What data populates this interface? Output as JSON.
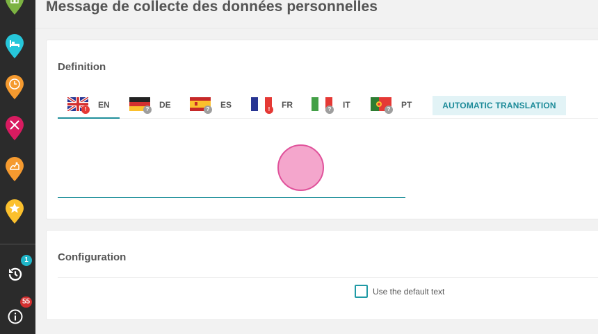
{
  "page": {
    "title": "Message de collecte des données personnelles"
  },
  "sidebar": {
    "pins": [
      {
        "icon": "building-icon",
        "color": "#7cb342"
      },
      {
        "icon": "bed-icon",
        "color": "#26c6da"
      },
      {
        "icon": "clock-icon",
        "color": "#f59a2f"
      },
      {
        "icon": "restaurant-icon",
        "color": "#d81b60"
      },
      {
        "icon": "leisure-icon",
        "color": "#f59a2f"
      },
      {
        "icon": "star-icon",
        "color": "#fbc02d"
      }
    ],
    "history": {
      "icon": "history-icon",
      "badge": "1",
      "badge_color": "#1fb6c9"
    },
    "info": {
      "icon": "info-icon",
      "badge": "55",
      "badge_color": "#d32f2f"
    }
  },
  "definition": {
    "title": "Definition",
    "tabs": [
      {
        "code": "EN",
        "flag": "uk-flag-icon",
        "badge": "!",
        "badge_type": "warn",
        "active": true
      },
      {
        "code": "DE",
        "flag": "germany-flag-icon",
        "badge": "?",
        "badge_type": "unk",
        "active": false
      },
      {
        "code": "ES",
        "flag": "spain-flag-icon",
        "badge": "?",
        "badge_type": "unk",
        "active": false
      },
      {
        "code": "FR",
        "flag": "france-flag-icon",
        "badge": "!",
        "badge_type": "warn",
        "active": false
      },
      {
        "code": "IT",
        "flag": "italy-flag-icon",
        "badge": "?",
        "badge_type": "unk",
        "active": false
      },
      {
        "code": "PT",
        "flag": "portugal-flag-icon",
        "badge": "?",
        "badge_type": "unk",
        "active": false
      }
    ],
    "auto_translation_label": "AUTOMATIC TRANSLATION",
    "editor_value": ""
  },
  "configuration": {
    "title": "Configuration",
    "checkbox_label": "Use the default text",
    "checkbox_checked": false
  },
  "colors": {
    "accent": "#1f8f9a",
    "sidebar_bg": "#2b2b2b"
  }
}
